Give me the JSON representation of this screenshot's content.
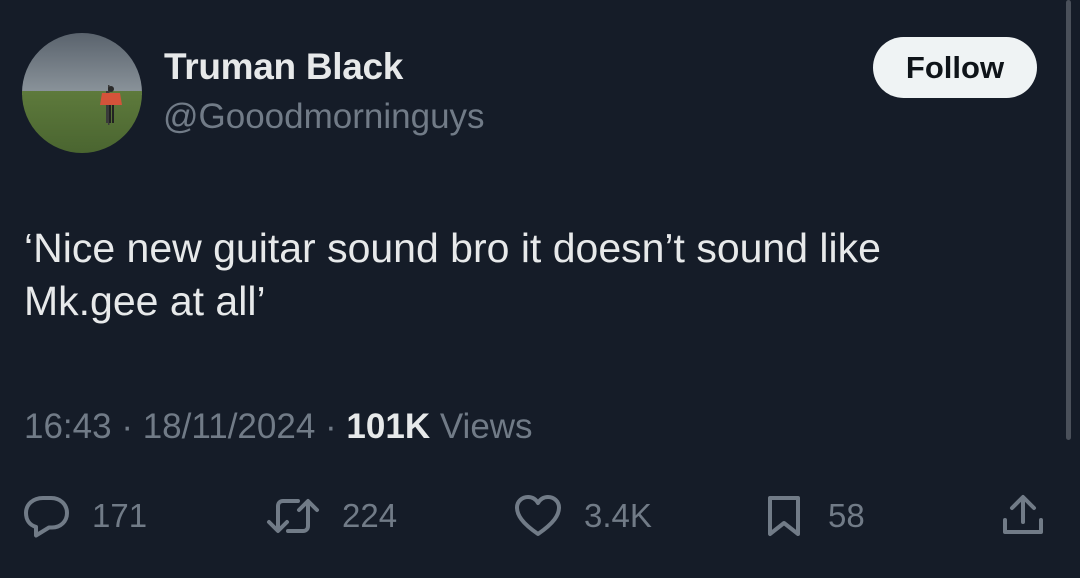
{
  "user": {
    "display_name": "Truman Black",
    "handle": "@Gooodmorninguys"
  },
  "follow_label": "Follow",
  "tweet": {
    "text_line1": "‘Nice new guitar sound bro it doesn’t sound like",
    "text_line2": "Mk.gee at all’",
    "time": "16:43",
    "date": "18/11/2024",
    "views_count": "101K",
    "views_label": "Views"
  },
  "actions": {
    "replies": "171",
    "reposts": "224",
    "likes": "3.4K",
    "bookmarks": "58"
  },
  "icons": [
    "reply-icon",
    "repost-icon",
    "like-icon",
    "bookmark-icon",
    "share-icon"
  ],
  "colors": {
    "background": "#151c28",
    "primary_text": "#e7e9ea",
    "secondary_text": "#717b87",
    "button_bg": "#eff3f4"
  }
}
